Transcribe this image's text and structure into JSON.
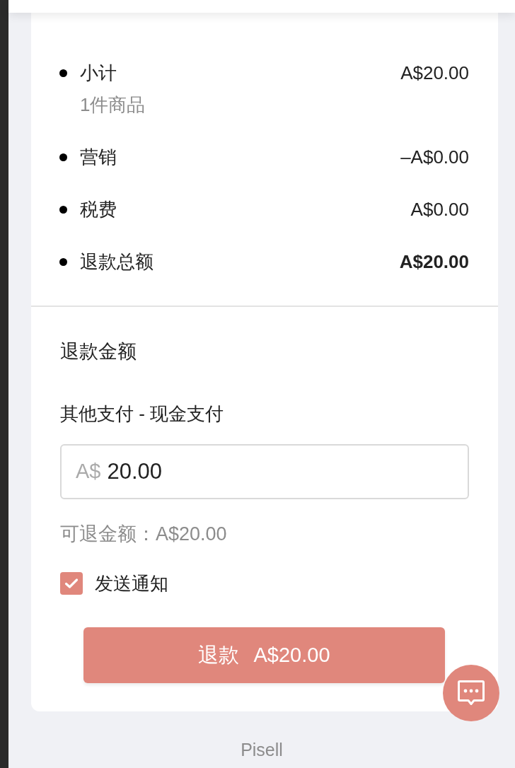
{
  "summary": {
    "items": [
      {
        "kind": "line",
        "label": "小计",
        "note": "1件商品",
        "amount": "A$20.00"
      },
      {
        "kind": "line",
        "label": "营销",
        "amount": "–A$0.00"
      },
      {
        "kind": "line",
        "label": "税费",
        "amount": "A$0.00"
      },
      {
        "kind": "total",
        "label": "退款总额",
        "amount": "A$20.00"
      }
    ]
  },
  "refund": {
    "title": "退款金额",
    "method": "其他支付 - 现金支付",
    "amount_field": {
      "prefix": "A$",
      "value": "20.00"
    },
    "refundable": "可退金额：A$20.00",
    "notify": {
      "label": "发送通知",
      "checked": true
    },
    "submit": {
      "label": "退款",
      "amount": "A$20.00"
    }
  },
  "footer": {
    "brand": "Pisell"
  }
}
